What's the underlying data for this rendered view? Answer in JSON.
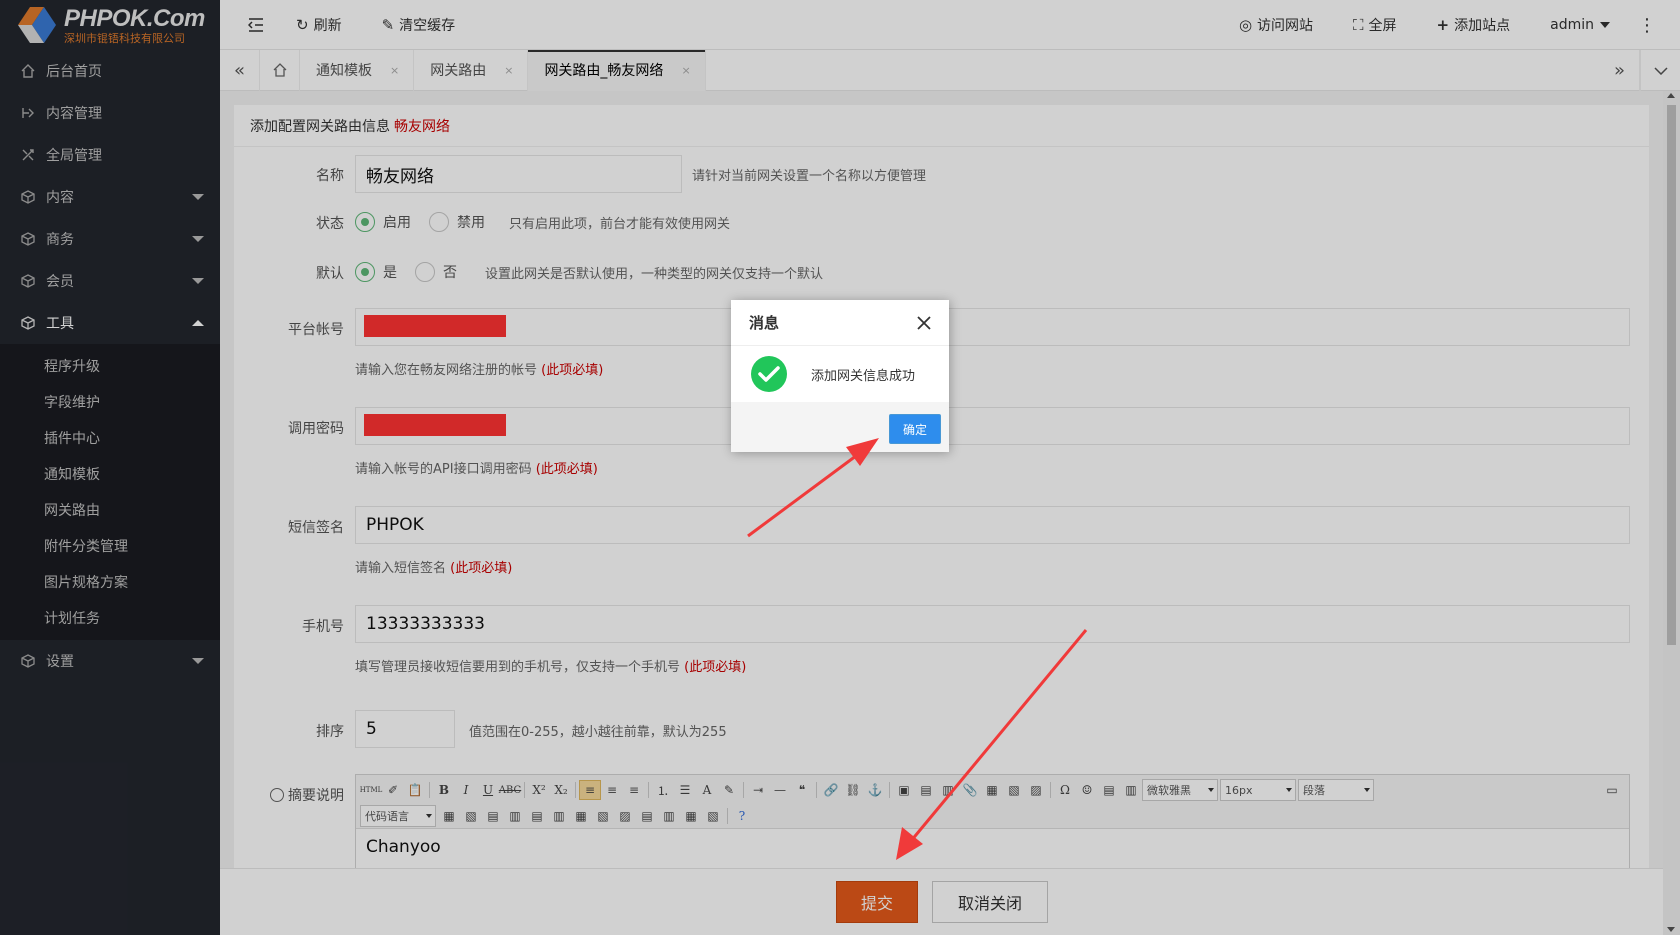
{
  "logo": {
    "title": "PHPOK.Com",
    "subtitle": "深圳市锟铻科技有限公司"
  },
  "sidebar": {
    "items": [
      {
        "label": "后台首页",
        "icon": "home-icon"
      },
      {
        "label": "内容管理",
        "icon": "content-icon"
      },
      {
        "label": "全局管理",
        "icon": "global-icon"
      },
      {
        "label": "内容",
        "icon": "cube-icon",
        "caret": "down"
      },
      {
        "label": "商务",
        "icon": "cube-icon",
        "caret": "down"
      },
      {
        "label": "会员",
        "icon": "cube-icon",
        "caret": "down"
      },
      {
        "label": "工具",
        "icon": "cube-icon",
        "caret": "up"
      }
    ],
    "sub_items": [
      "程序升级",
      "字段维护",
      "插件中心",
      "通知模板",
      "网关路由",
      "附件分类管理",
      "图片规格方案",
      "计划任务"
    ],
    "settings": "设置"
  },
  "topbar": {
    "refresh": "刷新",
    "clear_cache": "清空缓存",
    "visit_site": "访问网站",
    "fullscreen": "全屏",
    "add_site": "添加站点",
    "user": "admin"
  },
  "tabs": [
    {
      "label": "通知模板",
      "close": "×"
    },
    {
      "label": "网关路由",
      "close": "×"
    },
    {
      "label": "网关路由_畅友网络",
      "close": "×",
      "active": true
    }
  ],
  "form": {
    "header_prefix": "添加配置网关路由信息",
    "header_accent": "畅友网络",
    "name_label": "名称",
    "name_value": "畅友网络",
    "name_hint": "请针对当前网关设置一个名称以方便管理",
    "status_label": "状态",
    "status_on": "启用",
    "status_off": "禁用",
    "status_hint": "只有启用此项，前台才能有效使用网关",
    "default_label": "默认",
    "default_yes": "是",
    "default_no": "否",
    "default_hint": "设置此网关是否默认使用，一种类型的网关仅支持一个默认",
    "account_label": "平台帐号",
    "account_hint": "请输入您在畅友网络注册的帐号",
    "password_label": "调用密码",
    "password_hint": "请输入帐号的API接口调用密码",
    "sign_label": "短信签名",
    "sign_value": "PHPOK",
    "sign_hint": "请输入短信签名",
    "phone_label": "手机号",
    "phone_value": "13333333333",
    "phone_hint": "填写管理员接收短信要用到的手机号，仅支持一个手机号",
    "required": "(此项必填)",
    "sort_label": "排序",
    "sort_value": "5",
    "sort_hint": "值范围在0-255，越小越往前靠，默认为255",
    "summary_label": "摘要说明",
    "editor_font": "微软雅黑",
    "editor_size": "16px",
    "editor_para": "段落",
    "editor_code": "代码语言",
    "editor_content": "Chanyoo"
  },
  "bottom": {
    "submit": "提交",
    "cancel": "取消关闭"
  },
  "dialog": {
    "title": "消息",
    "message": "添加网关信息成功",
    "ok": "确定"
  },
  "colors": {
    "sidebar": "#23262e",
    "submit": "#e55a1a",
    "dialog_button": "#2e8ded",
    "success": "#21c65a",
    "arrow": "#f03a3a"
  }
}
